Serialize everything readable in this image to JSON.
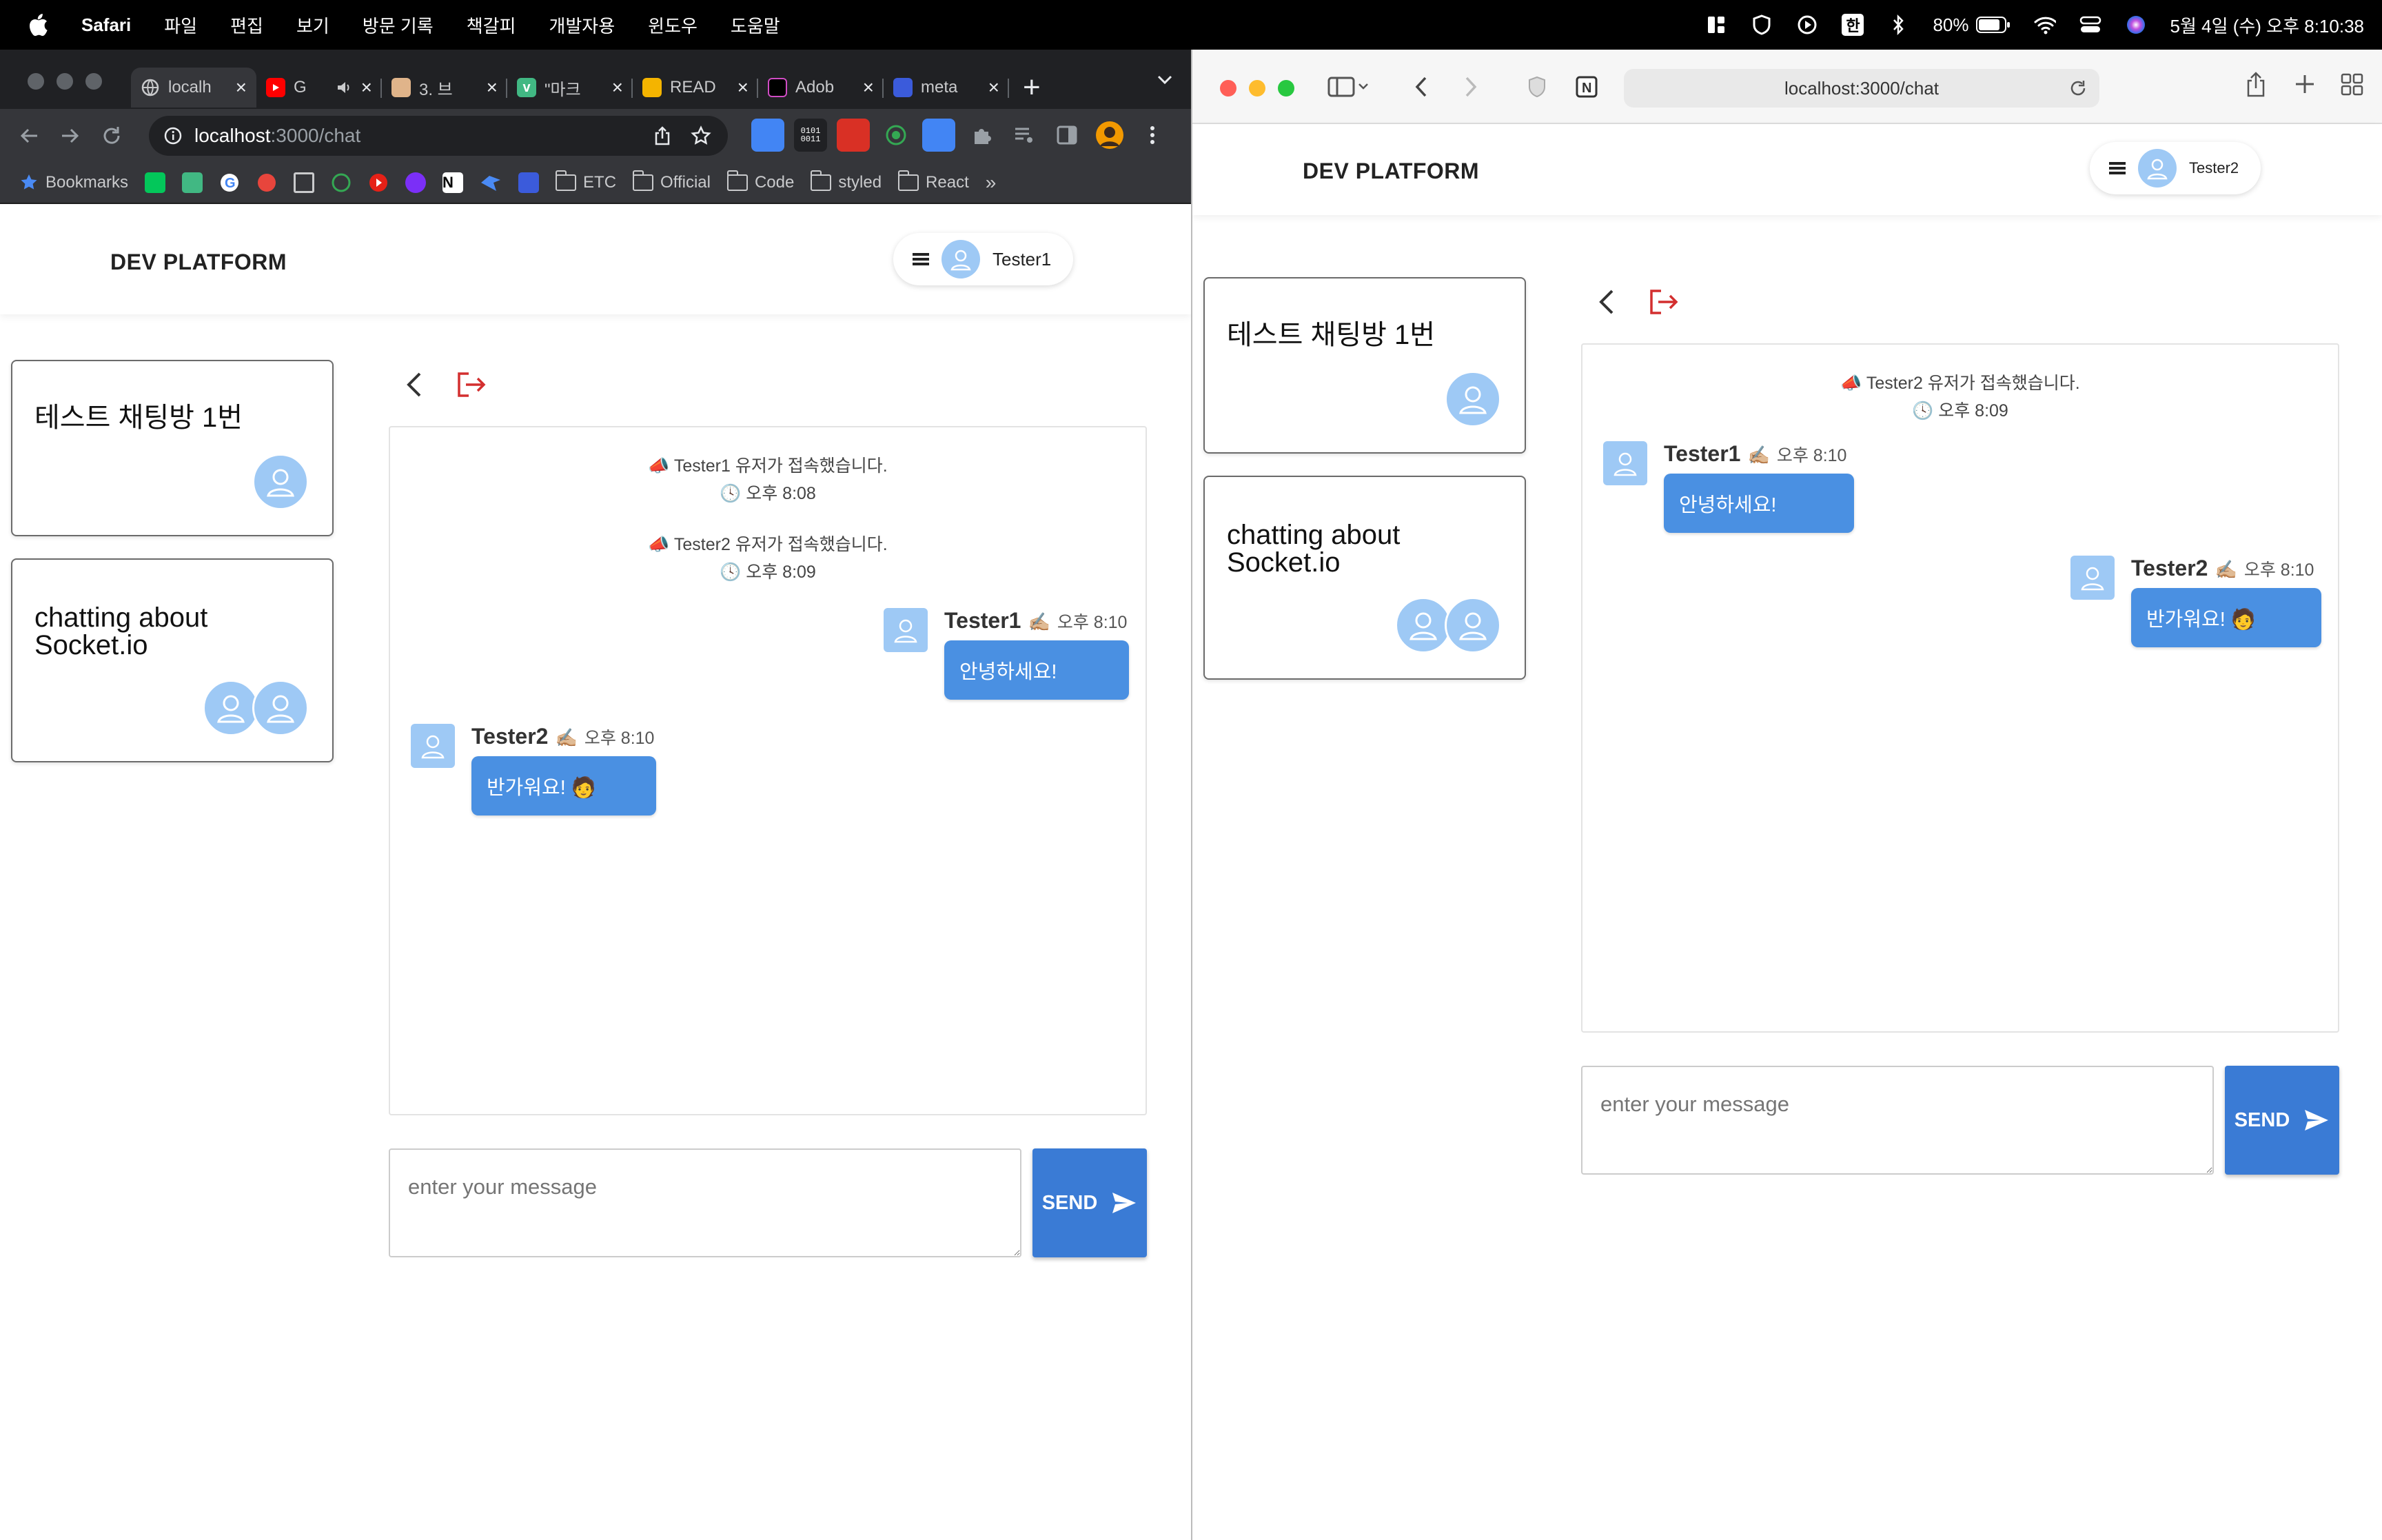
{
  "menubar": {
    "app": "Safari",
    "items": [
      "파일",
      "편집",
      "보기",
      "방문 기록",
      "책갈피",
      "개발자용",
      "윈도우",
      "도움말"
    ],
    "battery": "80%",
    "datetime": "5월 4일 (수) 오후 8:10:38",
    "ime": "한"
  },
  "chrome": {
    "tabs": [
      {
        "title": "localh",
        "icon": "globe-icon"
      },
      {
        "title": "G",
        "icon": "youtube-icon"
      },
      {
        "title": "3. 브",
        "icon": "hand-icon"
      },
      {
        "title": "\"마크",
        "icon": "v-icon"
      },
      {
        "title": "READ",
        "icon": "doc-icon"
      },
      {
        "title": "Adob",
        "icon": "adobe-icon"
      },
      {
        "title": "meta",
        "icon": "translate-icon"
      }
    ],
    "url_host": "localhost",
    "url_path": ":3000/chat",
    "bookmarks": [
      "Bookmarks",
      "ETC",
      "Official",
      "Code",
      "styled",
      "React"
    ]
  },
  "safari": {
    "url": "localhost:3000/chat"
  },
  "app": {
    "brand": "DEV PLATFORM",
    "input_placeholder": "enter your message",
    "send_label": "SEND",
    "rooms": [
      {
        "title_line1": "테스트 채팅방 1번",
        "title_line2": ""
      },
      {
        "title_line1": "chatting about",
        "title_line2": "Socket.io"
      }
    ]
  },
  "left_view": {
    "user": "Tester1",
    "system": [
      {
        "text": "📣 Tester1 유저가 접속했습니다.",
        "time": "🕓 오후 8:08"
      },
      {
        "text": "📣 Tester2 유저가 접속했습니다.",
        "time": "🕓 오후 8:09"
      }
    ],
    "messages": [
      {
        "sender": "Tester1",
        "emoji": "✍🏼",
        "time": "오후 8:10",
        "text": "안녕하세요!"
      },
      {
        "sender": "Tester2",
        "emoji": "✍🏼",
        "time": "오후 8:10",
        "text": "반가워요! 🧑"
      }
    ]
  },
  "right_view": {
    "user": "Tester2",
    "system": [
      {
        "text": "📣 Tester2 유저가 접속했습니다.",
        "time": "🕓 오후 8:09"
      }
    ],
    "messages": [
      {
        "sender": "Tester1",
        "emoji": "✍🏼",
        "time": "오후 8:10",
        "text": "안녕하세요!"
      },
      {
        "sender": "Tester2",
        "emoji": "✍🏼",
        "time": "오후 8:10",
        "text": "반가워요! 🧑"
      }
    ]
  },
  "colors": {
    "accent": "#3a7bd5",
    "bubble": "#4a90e2",
    "avatar": "#9ec9f5",
    "exit": "#d32f2f"
  }
}
